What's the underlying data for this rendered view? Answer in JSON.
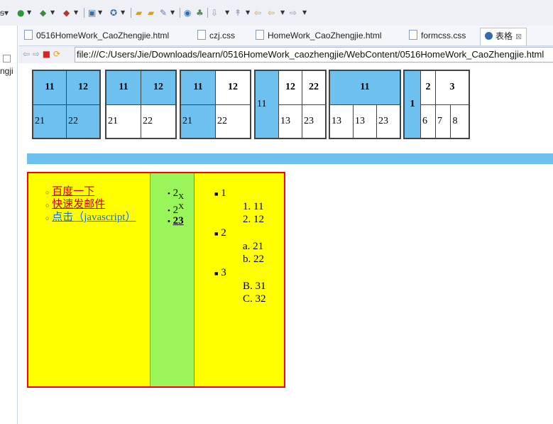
{
  "toolbar": {
    "icons": [
      "run-icon",
      "debug-icon",
      "external-tools-icon",
      "new-icon",
      "search-icon",
      "open-type-icon",
      "open-folder-icon",
      "pen-icon",
      "web-browser-icon",
      "new-server-icon",
      "annotation-icon",
      "last-edit-icon",
      "back-icon",
      "forward-icon"
    ]
  },
  "left_strip": {
    "partial_text": "ngji"
  },
  "tabs": [
    {
      "label": "0516HomeWork_CaoZhengjie.html",
      "active": false
    },
    {
      "label": "czj.css",
      "active": false
    },
    {
      "label": "HomeWork_CaoZhengjie.html",
      "active": false
    },
    {
      "label": "formcss.css",
      "active": false
    },
    {
      "label": "表格",
      "active": true,
      "close": "⊠"
    }
  ],
  "address": {
    "url": "file:///C:/Users/Jie/Downloads/learn/0516HomeWork_caozhengjie/WebContent/0516HomeWork_CaoZhengjie.html"
  },
  "tables": {
    "t1": {
      "r1": [
        "11",
        "12"
      ],
      "r2": [
        "21",
        "22"
      ]
    },
    "t2": {
      "r1": [
        "11",
        "12"
      ],
      "r2": [
        "21",
        "22"
      ]
    },
    "t3": {
      "r1": [
        "11",
        "12"
      ],
      "r2": [
        "21",
        "22"
      ]
    },
    "t4": {
      "rowspan": "11",
      "r1": [
        "12",
        "22"
      ],
      "r2": [
        "13",
        "23"
      ]
    },
    "t5": {
      "colspan": "11",
      "r2": [
        "13",
        "13",
        "23"
      ]
    },
    "t6": {
      "rowspan": "1",
      "r1": [
        "2",
        "3"
      ],
      "r2": [
        "6",
        "7",
        "8"
      ]
    }
  },
  "lists": {
    "links": [
      {
        "label": "百度一下",
        "color": "#c00000"
      },
      {
        "label": "快速发邮件",
        "color": "#c00000"
      },
      {
        "label": "点击（javascript）",
        "color": "#1a6fd6"
      }
    ],
    "formulas": [
      {
        "base": "2",
        "sub": "X"
      },
      {
        "base": "2",
        "sup": "X"
      },
      {
        "text": "23"
      }
    ],
    "nested": {
      "i1": "1",
      "i1_children": [
        "1. 11",
        "2. 12"
      ],
      "i2": "2",
      "i2_children": [
        "a. 21",
        "b. 22"
      ],
      "i3": "3",
      "i3_children": [
        "B. 31",
        "C. 32"
      ]
    }
  },
  "colors": {
    "cell_blue": "#6ec1ee",
    "yellow_panel": "#ffff00",
    "green_column": "#99f559",
    "red_border": "#ff0000"
  }
}
